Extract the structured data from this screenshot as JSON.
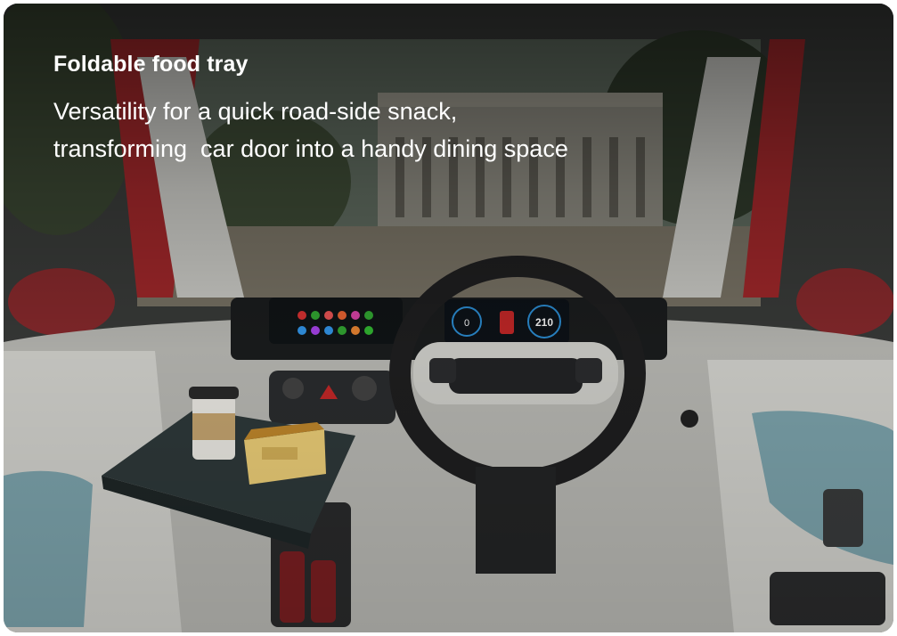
{
  "feature": {
    "title": "Foldable food tray",
    "description_lines": [
      "Versatility for a quick road-side snack,",
      "transforming  car door into a handy dining space"
    ]
  },
  "dashboard": {
    "speed_readout": "210",
    "gauge_readout": "0"
  },
  "colors": {
    "overlay": "#000000",
    "door_panel_teal": "#7fa7b0",
    "car_body_red": "#a3282b",
    "interior_light": "#d9d9d4",
    "tray_dark": "#2f3a3b"
  }
}
